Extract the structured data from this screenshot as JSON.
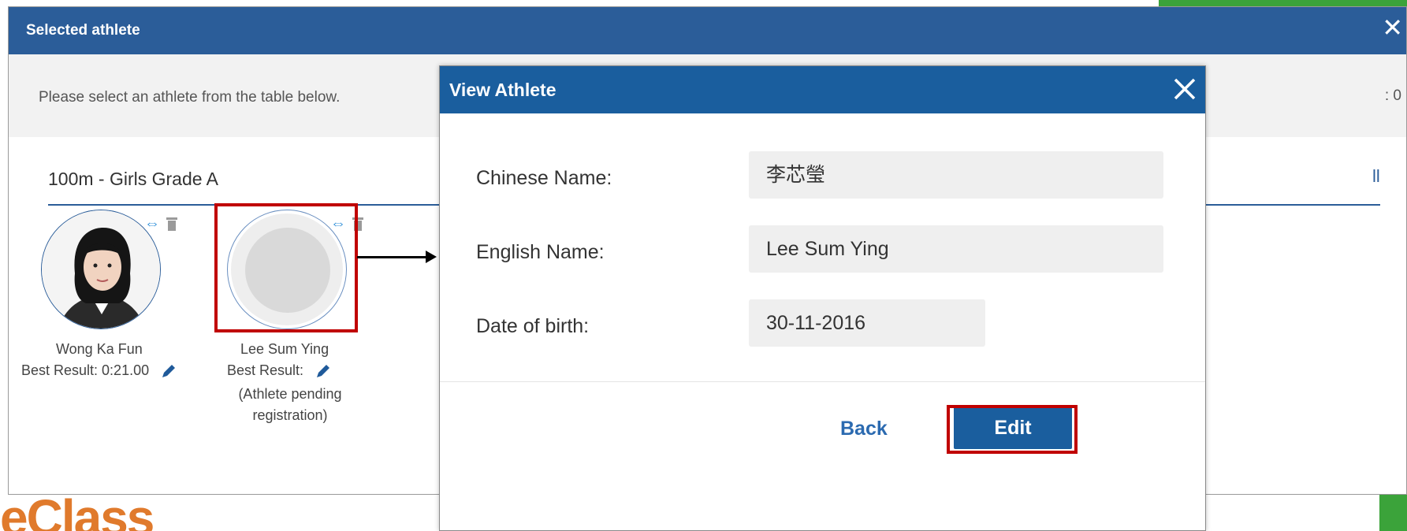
{
  "outer": {
    "title": "Selected athlete",
    "close": "✕",
    "instruction": "Please select an athlete from the table below.",
    "right_info": ": 0",
    "event_title": "100m - Girls Grade A",
    "view_all_fragment": "ll"
  },
  "athletes": [
    {
      "name": "Wong Ka Fun",
      "best_result": "Best Result: 0:21.00",
      "pending": ""
    },
    {
      "name": "Lee Sum Ying",
      "best_result": "Best Result:",
      "pending": "(Athlete pending registration)"
    }
  ],
  "modal": {
    "title": "View Athlete",
    "fields": [
      {
        "label": "Chinese Name:",
        "value": "李芯瑩"
      },
      {
        "label": "English Name:",
        "value": "Lee Sum Ying"
      },
      {
        "label": "Date of birth:",
        "value": "30-11-2016"
      }
    ],
    "back_label": "Back",
    "edit_label": "Edit"
  },
  "logo_fragment": "eClass",
  "colors": {
    "header_blue": "#2b5d99",
    "modal_blue": "#1a5e9e",
    "highlight_red": "#c00000",
    "green": "#3ba33a",
    "logo_orange": "#e07a2c"
  }
}
